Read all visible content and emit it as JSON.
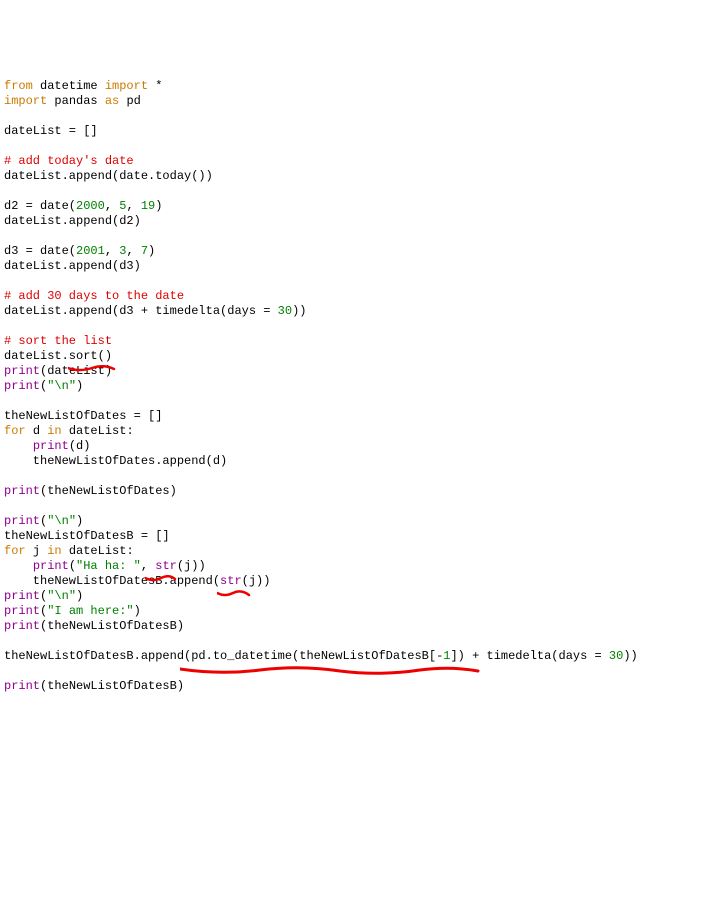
{
  "code": {
    "l1_from": "from",
    "l1_mod": "datetime",
    "l1_import": "import",
    "l1_star": "*",
    "l2_import": "import",
    "l2_pandas": "pandas",
    "l2_as": "as",
    "l2_pd": "pd",
    "l4": "dateList = []",
    "l6_comment": "# add today's date",
    "l7a": "dateList.append(date.today())",
    "l9a": "d2 = date(",
    "l9_n1": "2000",
    "l9b": ", ",
    "l9_n2": "5",
    "l9c": ", ",
    "l9_n3": "19",
    "l9d": ")",
    "l10": "dateList.append(d2)",
    "l12a": "d3 = date(",
    "l12_n1": "2001",
    "l12b": ", ",
    "l12_n2": "3",
    "l12c": ", ",
    "l12_n3": "7",
    "l12d": ")",
    "l13": "dateList.append(d3)",
    "l15_comment": "# add 30 days to the date",
    "l16a": "dateList.append(d3 + timedelta(days = ",
    "l16_n": "30",
    "l16b": "))",
    "l18_comment": "# sort the list",
    "l19": "dateList.sort()",
    "l20_print": "print",
    "l20_arg": "(dateList)",
    "l21_print": "print",
    "l21_po": "(",
    "l21_str": "\"\\n\"",
    "l21_pc": ")",
    "l23": "theNewListOfDates = []",
    "l24_for": "for",
    "l24_d": "d",
    "l24_in": "in",
    "l24_rest": "dateList:",
    "l25_print": "print",
    "l25_arg": "(d)",
    "l26": "    theNewListOfDates.append(d)",
    "l28_print": "print",
    "l28_arg": "(theNewListOfDates)",
    "l30_print": "print",
    "l30_po": "(",
    "l30_str": "\"\\n\"",
    "l30_pc": ")",
    "l31": "theNewListOfDatesB = []",
    "l32_for": "for",
    "l32_j": "j",
    "l32_in": "in",
    "l32_rest": "dateList:",
    "l33_print": "print",
    "l33_po": "(",
    "l33_str": "\"Ha ha: \"",
    "l33_c": ", ",
    "l33_strfn": "str",
    "l33_arg": "(j))",
    "l34a": "    theNewListOfDatesB.append(",
    "l34_strfn": "str",
    "l34b": "(j))",
    "l35_print": "print",
    "l35_po": "(",
    "l35_str": "\"\\n\"",
    "l35_pc": ")",
    "l36_print": "print",
    "l36_po": "(",
    "l36_str": "\"I am here:\"",
    "l36_pc": ")",
    "l37_print": "print",
    "l37_arg": "(theNewListOfDatesB)",
    "l39a": "theNewListOfDatesB.append(pd.to_datetime(theNewListOfDatesB[-",
    "l39_n1": "1",
    "l39b": "]) + timedelta(days = ",
    "l39_n2": "30",
    "l39c": "))",
    "l41_print": "print",
    "l41_arg": "(theNewListOfDatesB)"
  }
}
